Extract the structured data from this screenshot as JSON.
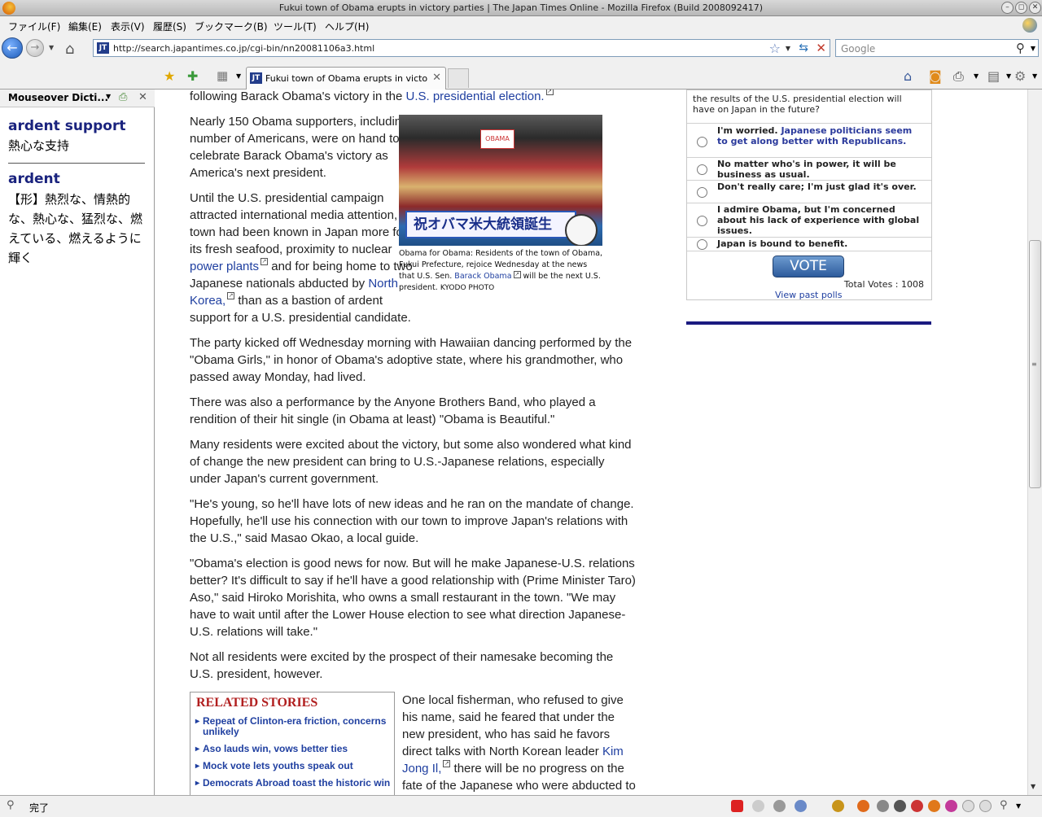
{
  "window": {
    "title": "Fukui town of Obama erupts in victory parties | The Japan Times Online - Mozilla Firefox (Build 2008092417)"
  },
  "menu": [
    "ファイル(F)",
    "編集(E)",
    "表示(V)",
    "履歴(S)",
    "ブックマーク(B)",
    "ツール(T)",
    "ヘルプ(H)"
  ],
  "nav": {
    "url": "http://search.japantimes.co.jp/cgi-bin/nn20081106a3.html",
    "search_placeholder": "Google"
  },
  "tabs": [
    {
      "label": "Fukui town of Obama erupts in victory ..."
    }
  ],
  "sidebar": {
    "title": "Mouseover Dicti...",
    "entries": [
      {
        "term": "ardent support",
        "definition": "熱心な支持"
      },
      {
        "term": "ardent",
        "definition": "【形】熱烈な、情熱的な、熱心な、猛烈な、燃えている、燃えるように輝く"
      }
    ]
  },
  "article": {
    "lead_fragment": "following Barack Obama's victory in the ",
    "lead_link": "U.S. presidential election.",
    "p1": "Nearly 150 Obama supporters, including a number of Americans, were on hand to celebrate Barack Obama's victory as America's next president.",
    "p2_a": "Until the U.S. presidential campaign attracted international media attention, the town had been known in Japan more for its fresh seafood, proximity to nuclear ",
    "p2_link1": "power plants",
    "p2_b": " and for being home to two Japanese nationals abducted by ",
    "p2_link2": "North Korea,",
    "p2_c": " than as a bastion of ardent support for a U.S. presidential candidate.",
    "p3": "The party kicked off Wednesday morning with Hawaiian dancing performed by the \"Obama Girls,\" in honor of Obama's adoptive state, where his grandmother, who passed away Monday, had lived.",
    "p4": "There was also a performance by the Anyone Brothers Band, who played a rendition of their hit single (in Obama at least) \"Obama is Beautiful.\"",
    "p5": "Many residents were excited about the victory, but some also wondered what kind of change the new president can bring to U.S.-Japanese relations, especially under Japan's current government.",
    "p6": "\"He's young, so he'll have lots of new ideas and he ran on the mandate of change. Hopefully, he'll use his connection with our town to improve Japan's relations with the U.S.,\" said Masao Okao, a local guide.",
    "p7": "\"Obama's election is good news for now. But will he make Japanese-U.S. relations better? It's difficult to say if he'll have a good relationship with (Prime Minister Taro) Aso,\" said Hiroko Morishita, who owns a small restaurant in the town. \"We may have to wait until after the Lower House election to see what direction Japanese-U.S. relations will take.\"",
    "p8": "Not all residents were excited by the prospect of their namesake becoming the U.S. president, however.",
    "p9_a": "One local fisherman, who refused to give his name, said he feared that under the new president, who has said he favors direct talks with North Korean leader ",
    "p9_link": "Kim Jong Il,",
    "p9_b": " there will be no progress on the fate of the Japanese who were abducted to North Korea."
  },
  "photo": {
    "banner_text": "祝オバマ米大統領誕生",
    "sign_text": "OBAMA",
    "caption_a": "Obama for Obama: Residents of the town of Obama, Fukui Prefecture, rejoice Wednesday at the news that U.S. Sen. ",
    "caption_link": "Barack Obama",
    "caption_b": " will be the next U.S. president.",
    "credit": "KYODO PHOTO"
  },
  "related": {
    "heading": "RELATED STORIES",
    "items": [
      "Repeat of Clinton-era friction, concerns unlikely",
      "Aso lauds win, vows better ties",
      "Mock vote lets youths speak out",
      "Democrats Abroad toast the historic win"
    ]
  },
  "poll": {
    "question": "the results of the U.S. presidential election will have on Japan in the future?",
    "options": [
      {
        "text": "I'm worried.",
        "highlight": "Japanese politicians seem to get along better with Republicans."
      },
      {
        "text": "No matter who's in power, it will be business as usual.",
        "highlight": ""
      },
      {
        "text": "Don't really care; I'm just glad it's over.",
        "highlight": ""
      },
      {
        "text": "I admire Obama, but I'm concerned about his lack of experience with global issues.",
        "highlight": ""
      },
      {
        "text": "Japan is bound to benefit.",
        "highlight": ""
      }
    ],
    "vote_label": "VOTE",
    "total_votes": "Total Votes : 1008",
    "past_polls": "View past polls"
  },
  "status": {
    "text": "完了"
  },
  "colors": {
    "link": "#1f3fa0",
    "related_heading": "#b11f1f",
    "dict_term": "#1a237e",
    "divider": "#1a1a80"
  }
}
